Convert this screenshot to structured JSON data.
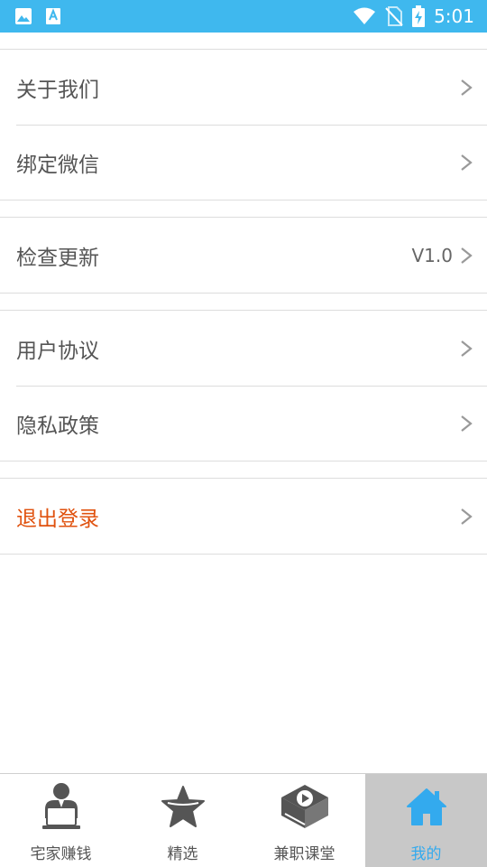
{
  "status_bar": {
    "time": "5:01",
    "left_icons": [
      "image-icon",
      "font-app-icon"
    ],
    "right_icons": [
      "wifi-icon",
      "no-sim-icon",
      "battery-charging-icon"
    ],
    "background_color": "#3fb8ee"
  },
  "settings": {
    "groups": [
      {
        "items": [
          {
            "label": "关于我们",
            "value": ""
          },
          {
            "label": "绑定微信",
            "value": ""
          }
        ]
      },
      {
        "items": [
          {
            "label": "检查更新",
            "value": "V1.0"
          }
        ]
      },
      {
        "items": [
          {
            "label": "用户协议",
            "value": ""
          },
          {
            "label": "隐私政策",
            "value": ""
          }
        ]
      },
      {
        "items": [
          {
            "label": "退出登录",
            "value": ""
          }
        ]
      }
    ],
    "danger_color": "#e0520f"
  },
  "bottom_nav": {
    "tabs": [
      {
        "label": "宅家赚钱",
        "icon": "person-laptop-icon"
      },
      {
        "label": "精选",
        "icon": "star-icon"
      },
      {
        "label": "兼职课堂",
        "icon": "book-play-icon"
      },
      {
        "label": "我的",
        "icon": "home-icon",
        "active": true
      }
    ],
    "active_color": "#33aaee"
  }
}
